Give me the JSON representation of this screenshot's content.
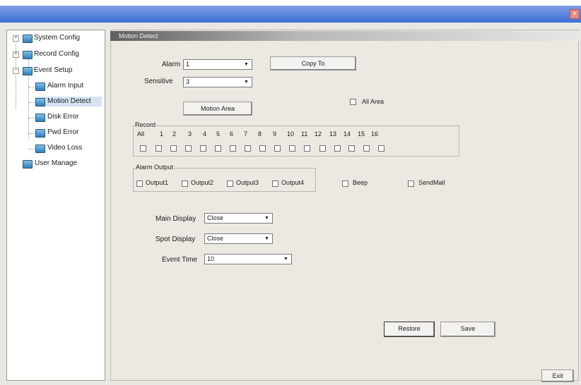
{
  "window": {
    "close_glyph": "×"
  },
  "tree": {
    "items": [
      {
        "label": "System Config",
        "expander": "+"
      },
      {
        "label": "Record Config",
        "expander": "+"
      },
      {
        "label": "Event Setup",
        "expander": "−"
      },
      {
        "label": "Alarm Input"
      },
      {
        "label": "Motion Detect"
      },
      {
        "label": "Disk Error"
      },
      {
        "label": "Pwd Error"
      },
      {
        "label": "Video Loss"
      },
      {
        "label": "User Manage"
      }
    ]
  },
  "panel": {
    "title": "Motion Detect",
    "alarm": {
      "label": "Alarm",
      "value": "1"
    },
    "sensitive": {
      "label": "Sensitive",
      "value": "3"
    },
    "copy_to": "Copy To",
    "motion_area": "Motion Area",
    "all_area": "All Area",
    "record": {
      "title": "Record",
      "channels": [
        "All",
        "1",
        "2",
        "3",
        "4",
        "5",
        "6",
        "7",
        "8",
        "9",
        "10",
        "11",
        "12",
        "13",
        "14",
        "15",
        "16"
      ]
    },
    "alarm_output": {
      "title": "Alarm Output",
      "outputs": [
        "Output1",
        "Output2",
        "Output3",
        "Output4"
      ]
    },
    "beep": "Beep",
    "send_mail": "SendMail",
    "main_display": {
      "label": "Main Display",
      "value": "Close"
    },
    "spot_display": {
      "label": "Spot Display",
      "value": "Close"
    },
    "event_time": {
      "label": "Event Time",
      "value": "10"
    },
    "restore": "Restore",
    "save": "Save",
    "exit": "Exit"
  }
}
